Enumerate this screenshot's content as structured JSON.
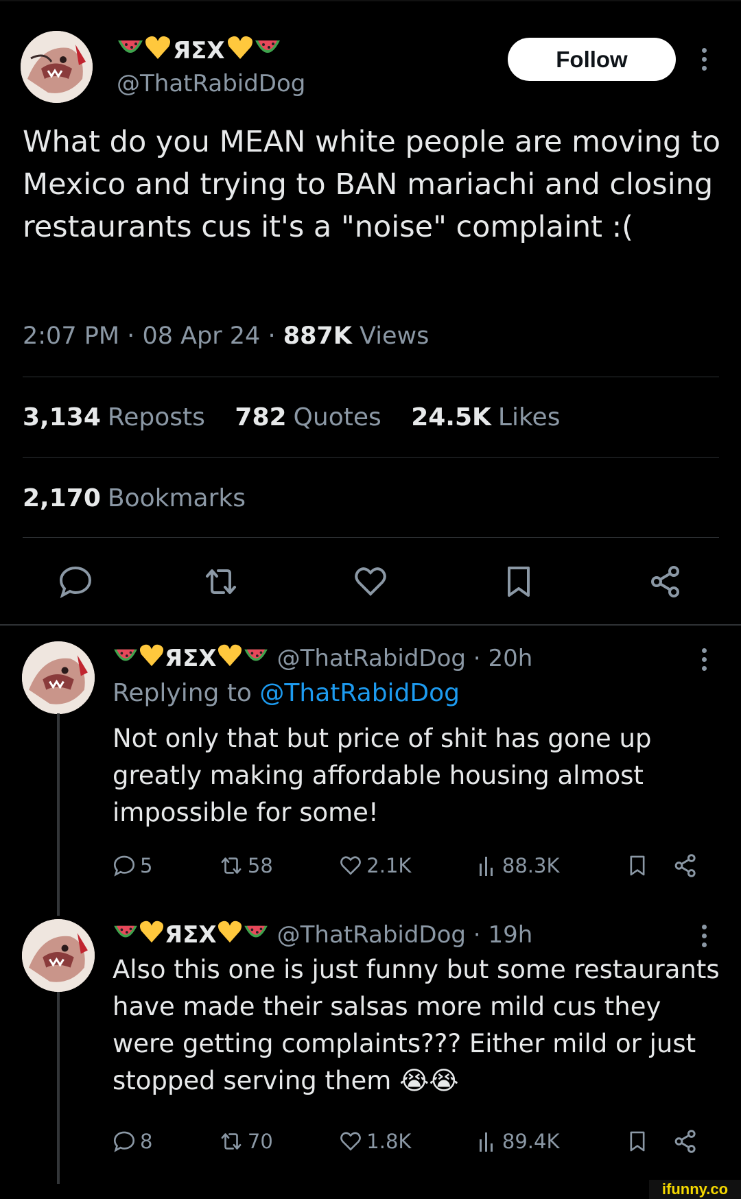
{
  "tweet": {
    "display_name": "ЯΣX",
    "handle": "@ThatRabidDog",
    "follow_label": "Follow",
    "text": "What do you MEAN white people are moving to Mexico and trying to BAN mariachi and closing restaurants cus it's a \"noise\" complaint :(",
    "time": "2:07 PM",
    "date": "08 Apr 24",
    "views_count": "887K",
    "views_label": "Views",
    "reposts_count": "3,134",
    "reposts_label": "Reposts",
    "quotes_count": "782",
    "quotes_label": "Quotes",
    "likes_count": "24.5K",
    "likes_label": "Likes",
    "bookmarks_count": "2,170",
    "bookmarks_label": "Bookmarks"
  },
  "replies": [
    {
      "display_name": "ЯΣX",
      "handle": "@ThatRabidDog",
      "age": "20h",
      "replying_prefix": "Replying to",
      "replying_handle": "@ThatRabidDog",
      "text": "Not only that but price of shit has gone up greatly making affordable housing almost impossible for some!",
      "replies": "5",
      "reposts": "58",
      "likes": "2.1K",
      "views": "88.3K"
    },
    {
      "display_name": "ЯΣX",
      "handle": "@ThatRabidDog",
      "age": "19h",
      "text": "Also this one is just funny but some restaurants have made their salsas more mild cus they were getting complaints??? Either mild or just stopped serving them",
      "text_emoji": "😭😭",
      "replies": "8",
      "reposts": "70",
      "likes": "1.8K",
      "views": "89.4K"
    }
  ],
  "watermark": "ifunny.co",
  "colors": {
    "background": "#000000",
    "text": "#e7e9ea",
    "muted": "#8b98a5",
    "link": "#1d9bf0",
    "divider": "#2f3336",
    "heart": "#ffc83d",
    "watermelon": "#e8485a"
  }
}
